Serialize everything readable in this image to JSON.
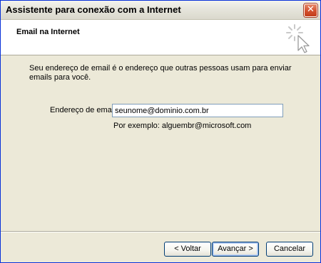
{
  "window": {
    "title": "Assistente para conexão com a Internet",
    "close_glyph": "✕"
  },
  "header": {
    "title": "Email na Internet",
    "icon": "cursor-arrow-icon"
  },
  "body": {
    "description": "Seu endereço de email é o endereço que outras pessoas usam para enviar emails para você.",
    "email_label": "Endereço de email:",
    "email_value": "seunome@dominio.com.br",
    "example": "Por exemplo: alguembr@microsoft.com"
  },
  "buttons": {
    "back": "< Voltar",
    "next": "Avançar >",
    "cancel": "Cancelar"
  },
  "colors": {
    "title_bar": "#e6e5dc",
    "dialog_bg": "#ece9d8",
    "header_bg": "#ffffff",
    "close_button": "#d3512f",
    "input_border": "#7f9db9"
  }
}
